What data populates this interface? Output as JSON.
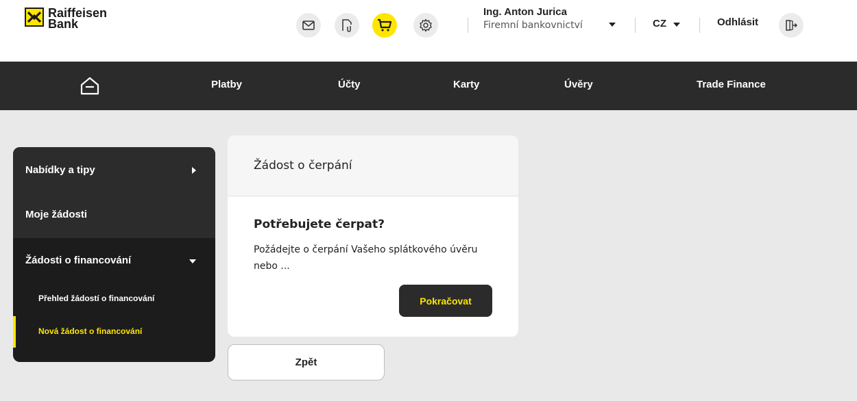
{
  "brand": {
    "logo_line1": "Raiffeisen",
    "logo_line2": "Bank",
    "accent": "#fee600",
    "dark": "#2b2b2b"
  },
  "header": {
    "icons": [
      "mail-icon",
      "document-attachment-icon",
      "cart-icon",
      "settings-gear-icon"
    ],
    "user_name": "Ing. Anton Jurica",
    "user_role": "Firemní bankovnictví",
    "language": "CZ",
    "logout_label": "Odhlásit"
  },
  "nav": {
    "home_icon": "home-icon",
    "items": [
      {
        "label": "Platby"
      },
      {
        "label": "Účty"
      },
      {
        "label": "Karty"
      },
      {
        "label": "Úvěry"
      },
      {
        "label": "Trade Finance"
      }
    ]
  },
  "sidebar": {
    "items": [
      {
        "label": "Nabídky a tipy"
      },
      {
        "label": "Moje žádosti"
      },
      {
        "label": "Žádosti o financování"
      },
      {
        "label": "Přehled žádostí o financování"
      },
      {
        "label": "Nová žádost o financování"
      }
    ]
  },
  "card": {
    "title": "Žádost o čerpání",
    "subtitle": "Potřebujete čerpat?",
    "text": "Požádejte o čerpání Vašeho splátkového úvěru nebo ...",
    "button": "Pokračovat"
  },
  "back_button": "Zpět"
}
